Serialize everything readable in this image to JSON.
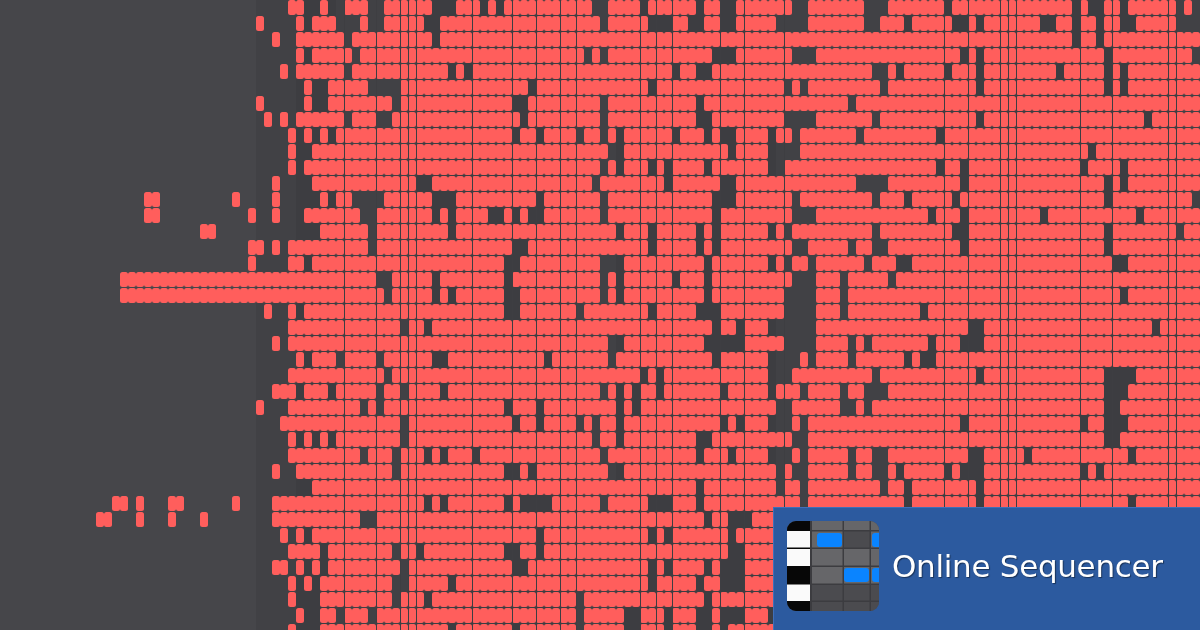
{
  "brand": {
    "name": "Online Sequencer"
  }
}
